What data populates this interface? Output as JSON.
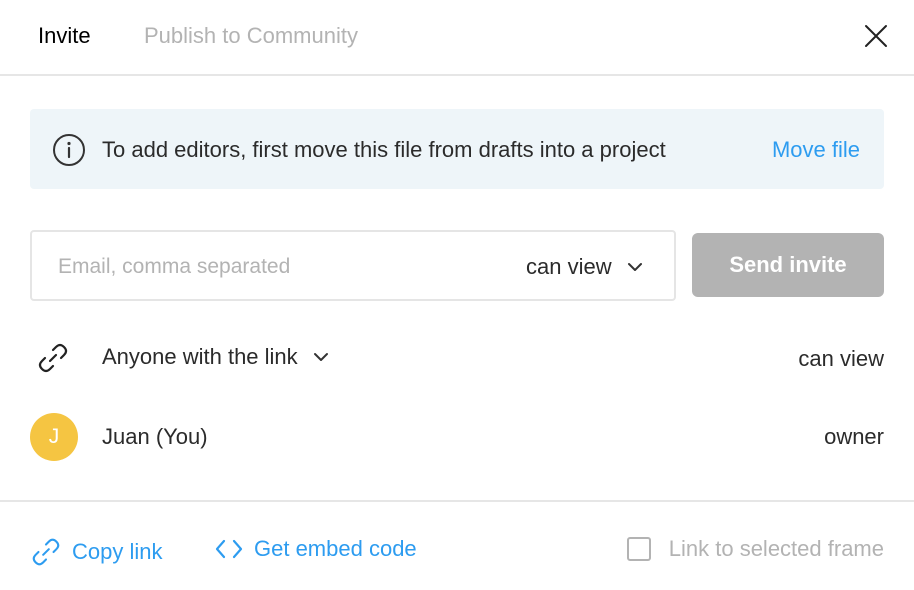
{
  "tabs": {
    "invite": "Invite",
    "publish": "Publish to Community"
  },
  "banner": {
    "message": "To add editors, first move this file from drafts into a project",
    "action": "Move file"
  },
  "invite_form": {
    "email_placeholder": "Email, comma separated",
    "email_value": "",
    "permission": "can view",
    "send_label": "Send invite"
  },
  "link_access": {
    "label": "Anyone with the link",
    "permission": "can view"
  },
  "members": [
    {
      "initial": "J",
      "name": "Juan (You)",
      "role": "owner"
    }
  ],
  "footer": {
    "copy_link": "Copy link",
    "embed_code": "Get embed code",
    "link_frame": "Link to selected frame",
    "link_frame_checked": false
  },
  "colors": {
    "accent": "#2d9cf0",
    "banner_bg": "#eef5f9",
    "disabled_button": "#b3b3b3",
    "avatar": "#f5c542"
  },
  "icons": {
    "close": "close-icon",
    "info": "info-icon",
    "chevron": "chevron-down-icon",
    "link": "link-icon",
    "code": "code-icon",
    "checkbox": "checkbox-icon"
  }
}
